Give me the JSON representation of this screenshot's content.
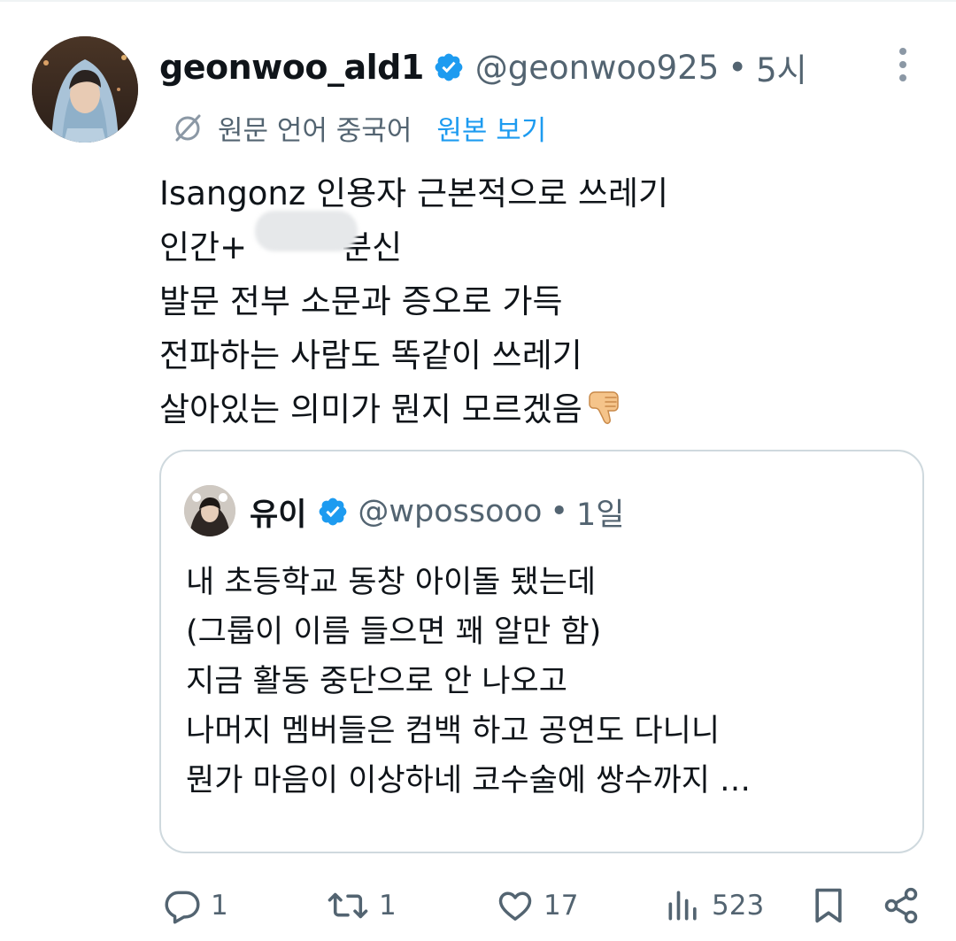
{
  "tweet": {
    "display_name": "geonwoo_ald1",
    "handle": "@geonwoo925",
    "separator": "•",
    "time": "5시",
    "translation": {
      "source_language": "원문 언어 중국어",
      "view_original": "원본 보기"
    },
    "lines": [
      "Isangonz 인용자 근본적으로 쓰레기",
      "인간+",
      "발문 전부 소문과 증오로 가득",
      "전파하는 사람도 똑같이 쓰레기",
      "살아있는 의미가 뭔지 모르겠음"
    ],
    "line2_tail": "분신",
    "emoji": "thumbs-down"
  },
  "quote": {
    "display_name": "유이",
    "handle": "@wpossooo",
    "separator": "•",
    "time": "1일",
    "lines": [
      "내 초등학교 동창 아이돌 됐는데",
      "(그룹이 이름 들으면 꽤 알만 함)",
      "지금 활동 중단으로 안 나오고",
      "나머지 멤버들은 컴백 하고 공연도 다니니",
      "뭔가 마음이 이상하네 코수술에 쌍수까지 …"
    ]
  },
  "actions": {
    "reply_count": "1",
    "retweet_count": "1",
    "like_count": "17",
    "view_count": "523"
  },
  "colors": {
    "text_primary": "#0f1419",
    "text_secondary": "#536471",
    "accent": "#1d9bf0",
    "border": "#cfd9de"
  }
}
